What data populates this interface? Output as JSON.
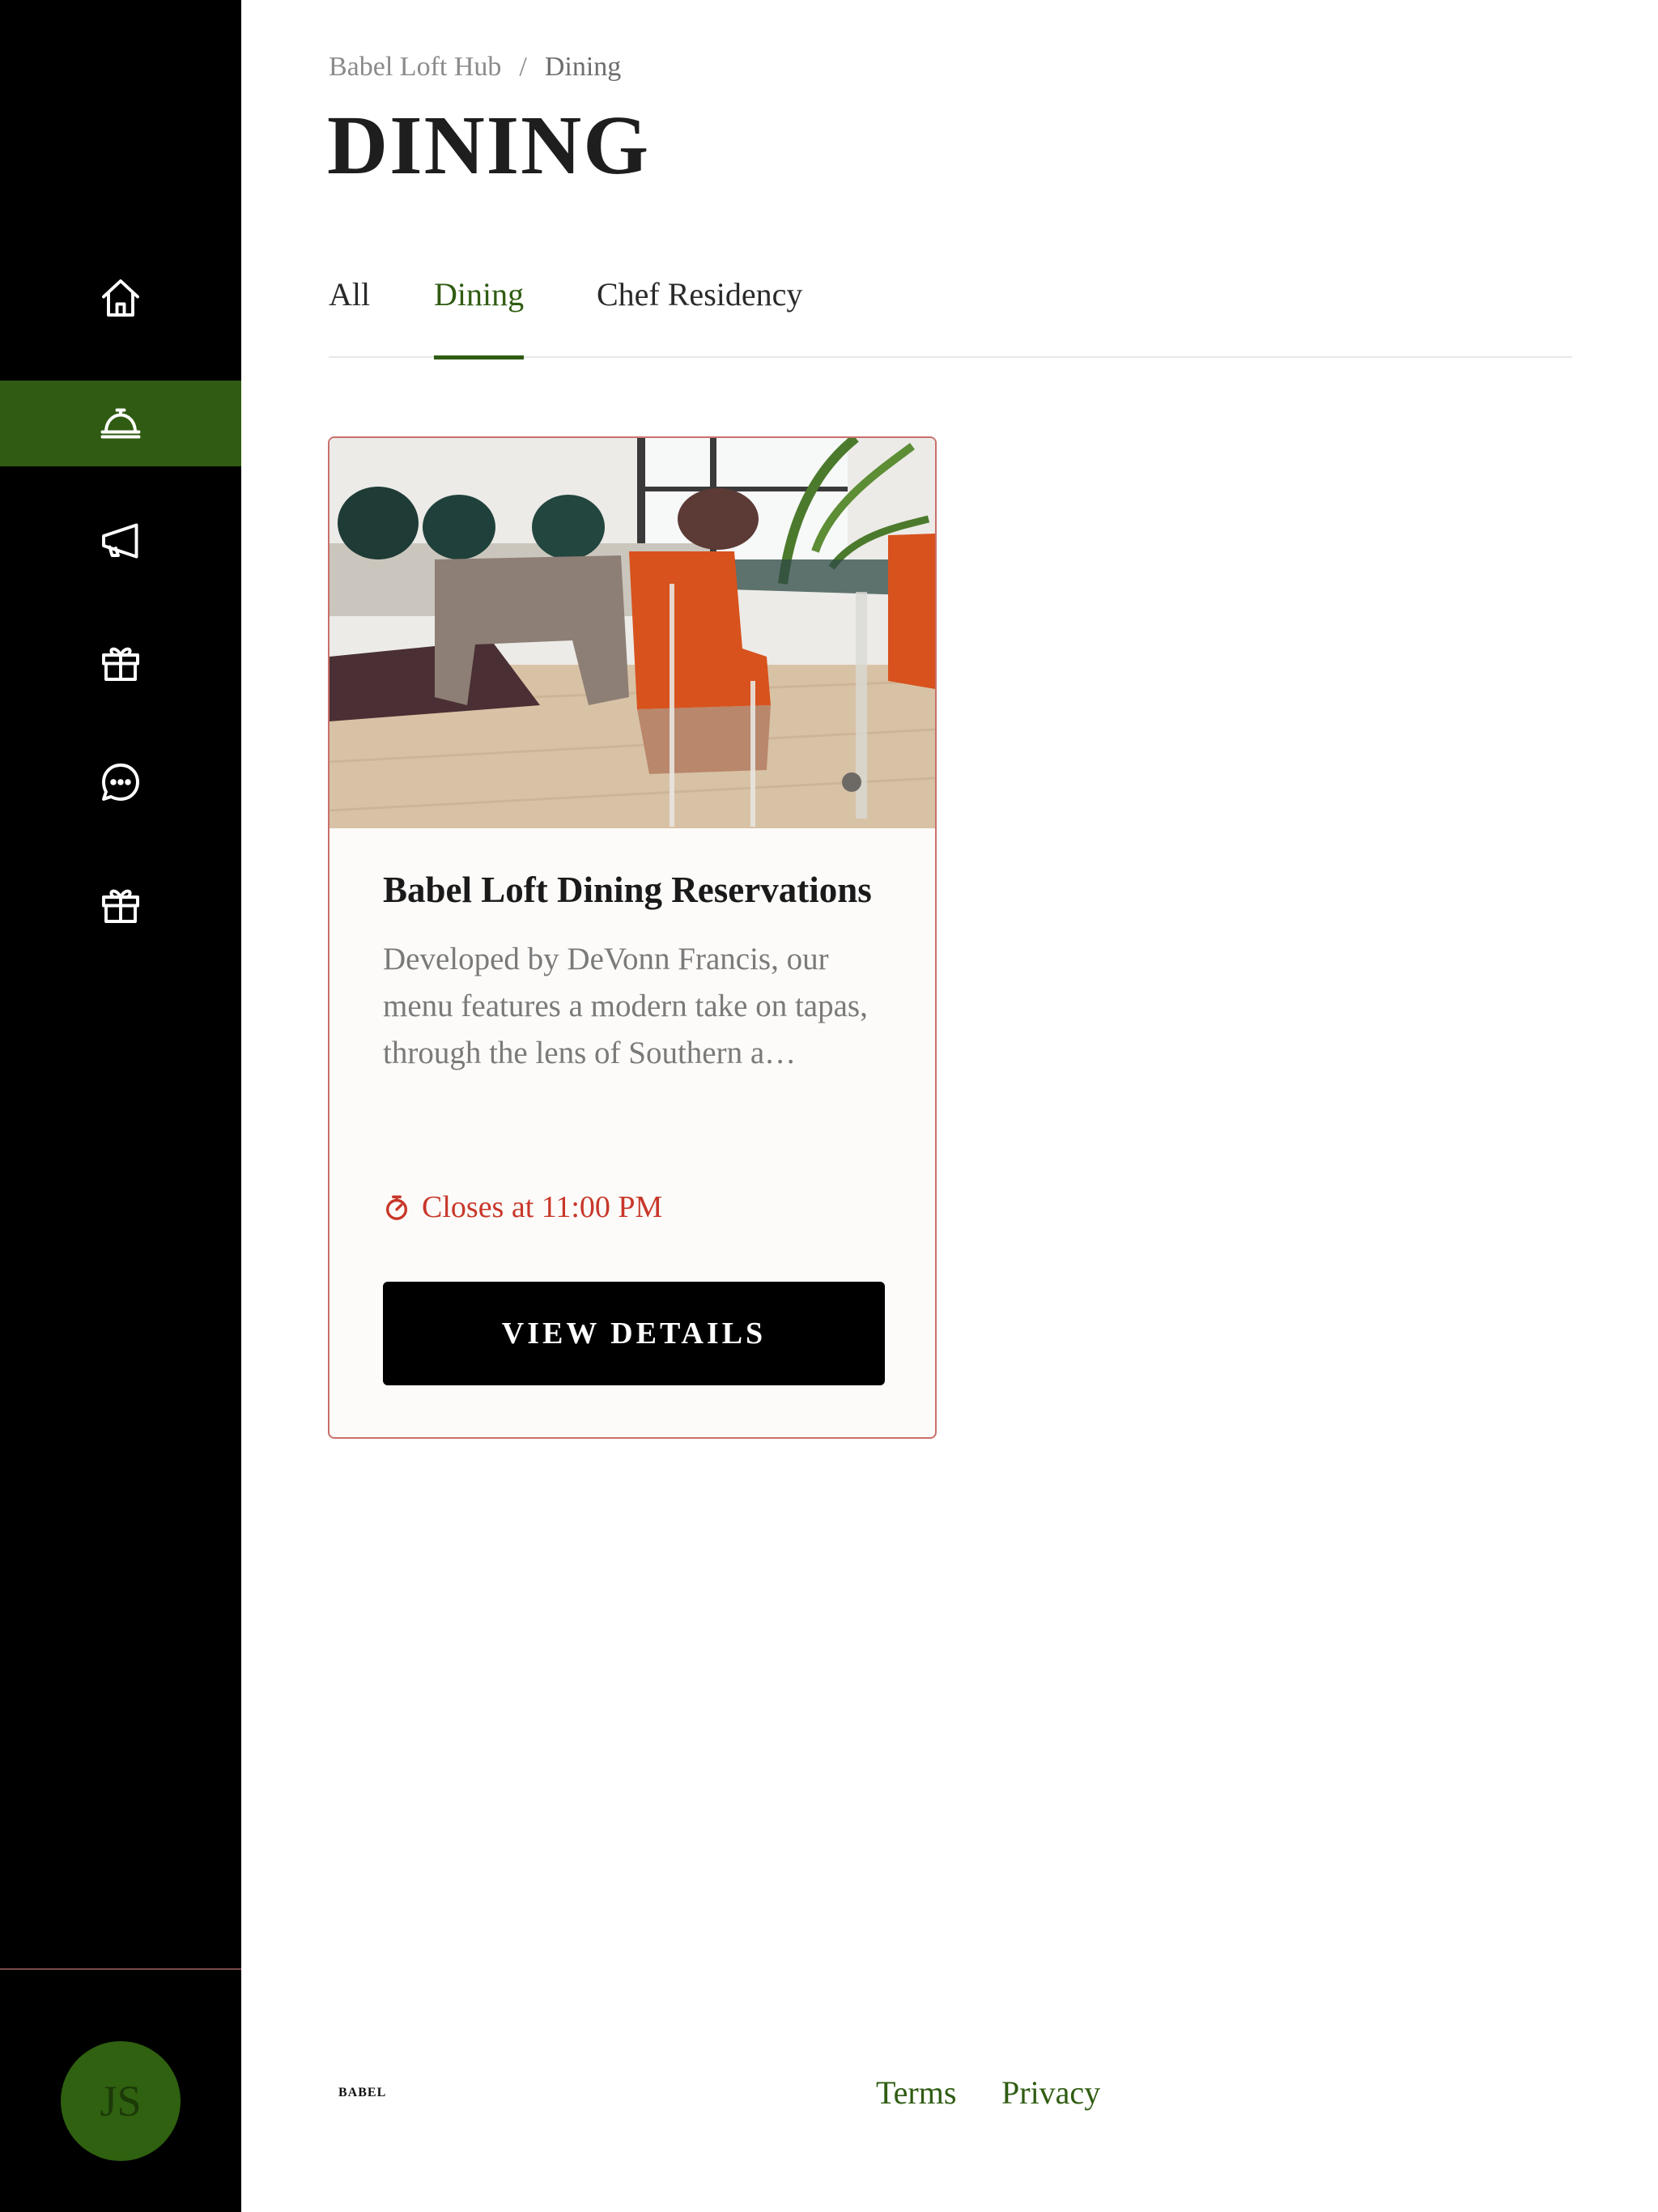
{
  "sidebar": {
    "items": [
      {
        "icon": "home-icon",
        "label": "Home"
      },
      {
        "icon": "concierge-bell-icon",
        "label": "Dining",
        "active": true
      },
      {
        "icon": "megaphone-icon",
        "label": "Announcements"
      },
      {
        "icon": "gift-icon",
        "label": "Perks"
      },
      {
        "icon": "chat-icon",
        "label": "Messages"
      },
      {
        "icon": "gift-icon",
        "label": "Rewards"
      }
    ],
    "avatar_initials": "JS",
    "active_color": "#2f5c12"
  },
  "breadcrumb": {
    "root": "Babel Loft Hub",
    "separator": "/",
    "current": "Dining"
  },
  "page_title": "DINING",
  "tabs": [
    {
      "label": "All"
    },
    {
      "label": "Dining",
      "active": true
    },
    {
      "label": "Chef Residency"
    }
  ],
  "card": {
    "title": "Babel Loft Dining Reservations",
    "description": "Developed by DeVonn Francis, our menu features a modern take on tapas, through the lens of Southern a…",
    "hours": "Closes at 11:00 PM",
    "button_label": "VIEW DETAILS",
    "status_color": "#c8372a"
  },
  "footer": {
    "logo_text": "BABEL",
    "terms": "Terms",
    "privacy": "Privacy"
  }
}
